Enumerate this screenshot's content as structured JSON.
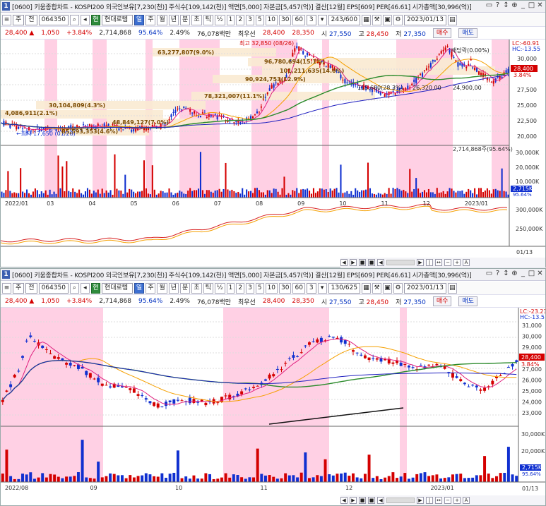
{
  "windows": [
    {
      "id": "w1",
      "title": "[0600] 키움종합차트 - KOSPI200 외국인보유[7,230(천)] 주식수[109,142(천)] 액면[5,000] 자본금[5,457(억)] 결산[12월] EPS[609] PER[46.61] 시가총액[30,996(억)]",
      "number": "1",
      "toolbar": {
        "market": "주",
        "code_type": "전",
        "code": "064350",
        "stock_name": "현대로템",
        "periods": [
          "일",
          "주",
          "월",
          "년",
          "분",
          "초",
          "틱"
        ],
        "ratio": "½",
        "minutes": [
          "1",
          "2",
          "3",
          "5",
          "10",
          "30",
          "60"
        ],
        "dropdown": "3",
        "count": "243/600",
        "date": "2023/01/13"
      },
      "price": {
        "last": "28,400",
        "change": "1,050",
        "rate": "+3.84%",
        "volume": "2,714,868",
        "vol_ratio": "95.64%",
        "turnover": "2.49%",
        "amount": "76,078백만",
        "best_bid": "최우선",
        "bid1": "28,400",
        "bid2": "28,350",
        "open_label": "시",
        "open": "27,550",
        "high_label": "고",
        "high": "28,450",
        "low_label": "저",
        "low": "27,350",
        "buy": "매수",
        "sell": "매도"
      },
      "chart": {
        "axis_right": [
          "30,000",
          "27,500",
          "25,000",
          "22,500",
          "20,000"
        ],
        "tag_lc": "LC:-60.91",
        "tag_hc": "HC:-13.55",
        "tag_price": "28,400",
        "tag_rate": "3.84%",
        "annotations": {
          "high": "최고 32,850 (08/26)",
          "low": "←최저 17,650 (01/28)",
          "dividend": "배당락(0.00%)",
          "l1": "63,277,807(9.0%)",
          "l2": "96,780,694(15.1%)",
          "l3": "101,211,635(14.6%)",
          "l4": "90,924,753(12.9%)",
          "l5": "78,321,007(11.1%)",
          "l6": "30,104,809(4.3%)",
          "l7": "4,086,911(2.1%)",
          "l8": "85,593,353(4.6%)",
          "l9": "48,849,127(7.0%)",
          "l10": "115,660(28.3%)",
          "l11": "26,320,00",
          "l12": "24,900,00"
        },
        "vol_label": "2,714,868주(95.64%)",
        "vol_axis": [
          "30,000K",
          "20,000K",
          "10,000K"
        ],
        "vol_tag": "2,715K",
        "vol_tag2": "95.64%",
        "ind_axis": [
          "300,000K",
          "250,000K"
        ],
        "months": [
          "2022/01",
          "03",
          "04",
          "05",
          "06",
          "07",
          "08",
          "09",
          "10",
          "11",
          "12",
          "2023/01"
        ],
        "last_label": "01/13"
      }
    },
    {
      "id": "w2",
      "title": "[0600] 키움종합차트 - KOSPI200 외국인보유[7,230(천)] 주식수[109,142(천)] 액면[5,000] 자본금[5,457(억)] 결산[12월] EPS[609] PER[46.61] 시가총액[30,996(억)]",
      "number": "1",
      "toolbar": {
        "market": "주",
        "code_type": "전",
        "code": "064350",
        "stock_name": "현대로템",
        "periods": [
          "일",
          "주",
          "월",
          "년",
          "분",
          "초",
          "틱"
        ],
        "ratio": "½",
        "minutes": [
          "1",
          "2",
          "3",
          "5",
          "10",
          "30",
          "60"
        ],
        "dropdown": "3",
        "count": "130/625",
        "date": "2023/01/13"
      },
      "price": {
        "last": "28,400",
        "change": "1,050",
        "rate": "+3.84%",
        "volume": "2,714,868",
        "vol_ratio": "95.64%",
        "turnover": "2.49%",
        "amount": "76,078백만",
        "best_bid": "최우선",
        "bid1": "28,400",
        "bid2": "28,350",
        "open_label": "시",
        "open": "27,550",
        "high_label": "고",
        "high": "28,450",
        "low_label": "저",
        "low": "27,350",
        "buy": "매수",
        "sell": "매도"
      },
      "chart": {
        "axis_right": [
          "31,000",
          "30,000",
          "29,000",
          "28,000",
          "27,000",
          "26,000",
          "25,000",
          "24,000",
          "23,000"
        ],
        "tag_lc": "LC:-23.21",
        "tag_hc": "HC:-13.5",
        "tag_price": "28,400",
        "tag_rate": "3.84%",
        "vol_axis": [
          "30,000K",
          "20,000K"
        ],
        "vol_tag": "2,715K",
        "vol_tag2": "95.64%",
        "months": [
          "2022/08",
          "09",
          "10",
          "11",
          "12",
          "2023/01"
        ],
        "last_label": "01/13"
      }
    }
  ],
  "colors": {
    "up": "#d40000",
    "down": "#1030d0",
    "pink": "#ffd0e4",
    "beige": "#f9ead2",
    "ma5": "#e0207f",
    "ma20": "#f5a000",
    "ma60": "#2a8a2a",
    "ma120": "#2020c0"
  }
}
